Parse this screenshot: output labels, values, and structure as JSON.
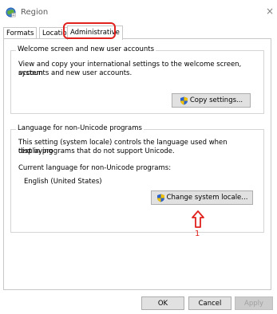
{
  "window": {
    "title": "Region",
    "app_icon": "region-globe-icon",
    "close_icon": "close-icon",
    "close_glyph": "×"
  },
  "tabs": [
    {
      "label": "Formats",
      "active": false
    },
    {
      "label": "Location",
      "active": false
    },
    {
      "label": "Administrative",
      "active": true
    }
  ],
  "welcome": {
    "legend": "Welcome screen and new user accounts",
    "description_line1": "View and copy your international settings to the welcome screen, system",
    "description_line2": "accounts and new user accounts.",
    "copy_button": "Copy settings..."
  },
  "unicode": {
    "legend": "Language for non-Unicode programs",
    "description_line1": "This setting (system locale) controls the language used when displaying",
    "description_line2": "text in programs that do not support Unicode.",
    "current_label": "Current language for non-Unicode programs:",
    "current_value": "English (United States)",
    "change_button": "Change system locale..."
  },
  "annotation": {
    "number": "1",
    "color": "#e0211d",
    "arrow_icon": "up-arrow-icon"
  },
  "footer": {
    "ok": "OK",
    "cancel": "Cancel",
    "apply": "Apply"
  },
  "colors": {
    "highlight": "#e0211d",
    "button_bg": "#e1e1e1",
    "shield_blue": "#2a62c9",
    "shield_yellow": "#f2c200"
  }
}
